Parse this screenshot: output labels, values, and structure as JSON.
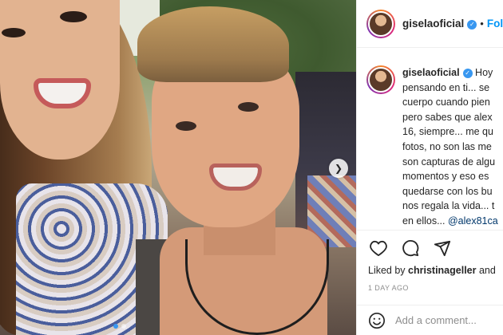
{
  "post": {
    "username": "giselaoficial",
    "follow_label": "Fol",
    "separator": "•",
    "verified_glyph": "✓",
    "caption_username": "giselaoficial",
    "caption_lines": [
      "Hoy",
      "pensando en ti... se",
      "cuerpo cuando pien",
      "pero sabes que alex",
      "16, siempre... me qu",
      "fotos, no son las me",
      "son capturas de algu",
      "momentos y eso es",
      "quedarse con los bu",
      "nos regala la vida... t"
    ],
    "caption_last_prefix": "en ellos... ",
    "caption_mention": "@alex81ca",
    "liked_by_prefix": "Liked by ",
    "liked_by_user": "christinageller",
    "liked_by_suffix": " and",
    "time_ago": "1 DAY AGO",
    "comment_placeholder": "Add a comment...",
    "carousel": {
      "total": 2,
      "active": 0
    }
  },
  "icons": {
    "avatar": "profile-photo",
    "verified": "verified-badge-icon",
    "like": "heart-icon",
    "comment": "comment-bubble-icon",
    "share": "paper-plane-icon",
    "emoji": "smiley-icon",
    "next": "chevron-right-icon"
  },
  "colors": {
    "link_blue": "#0095f6",
    "verified_blue": "#3897f0",
    "text": "#262626",
    "muted": "#8e8e8e",
    "border": "#efefef"
  }
}
